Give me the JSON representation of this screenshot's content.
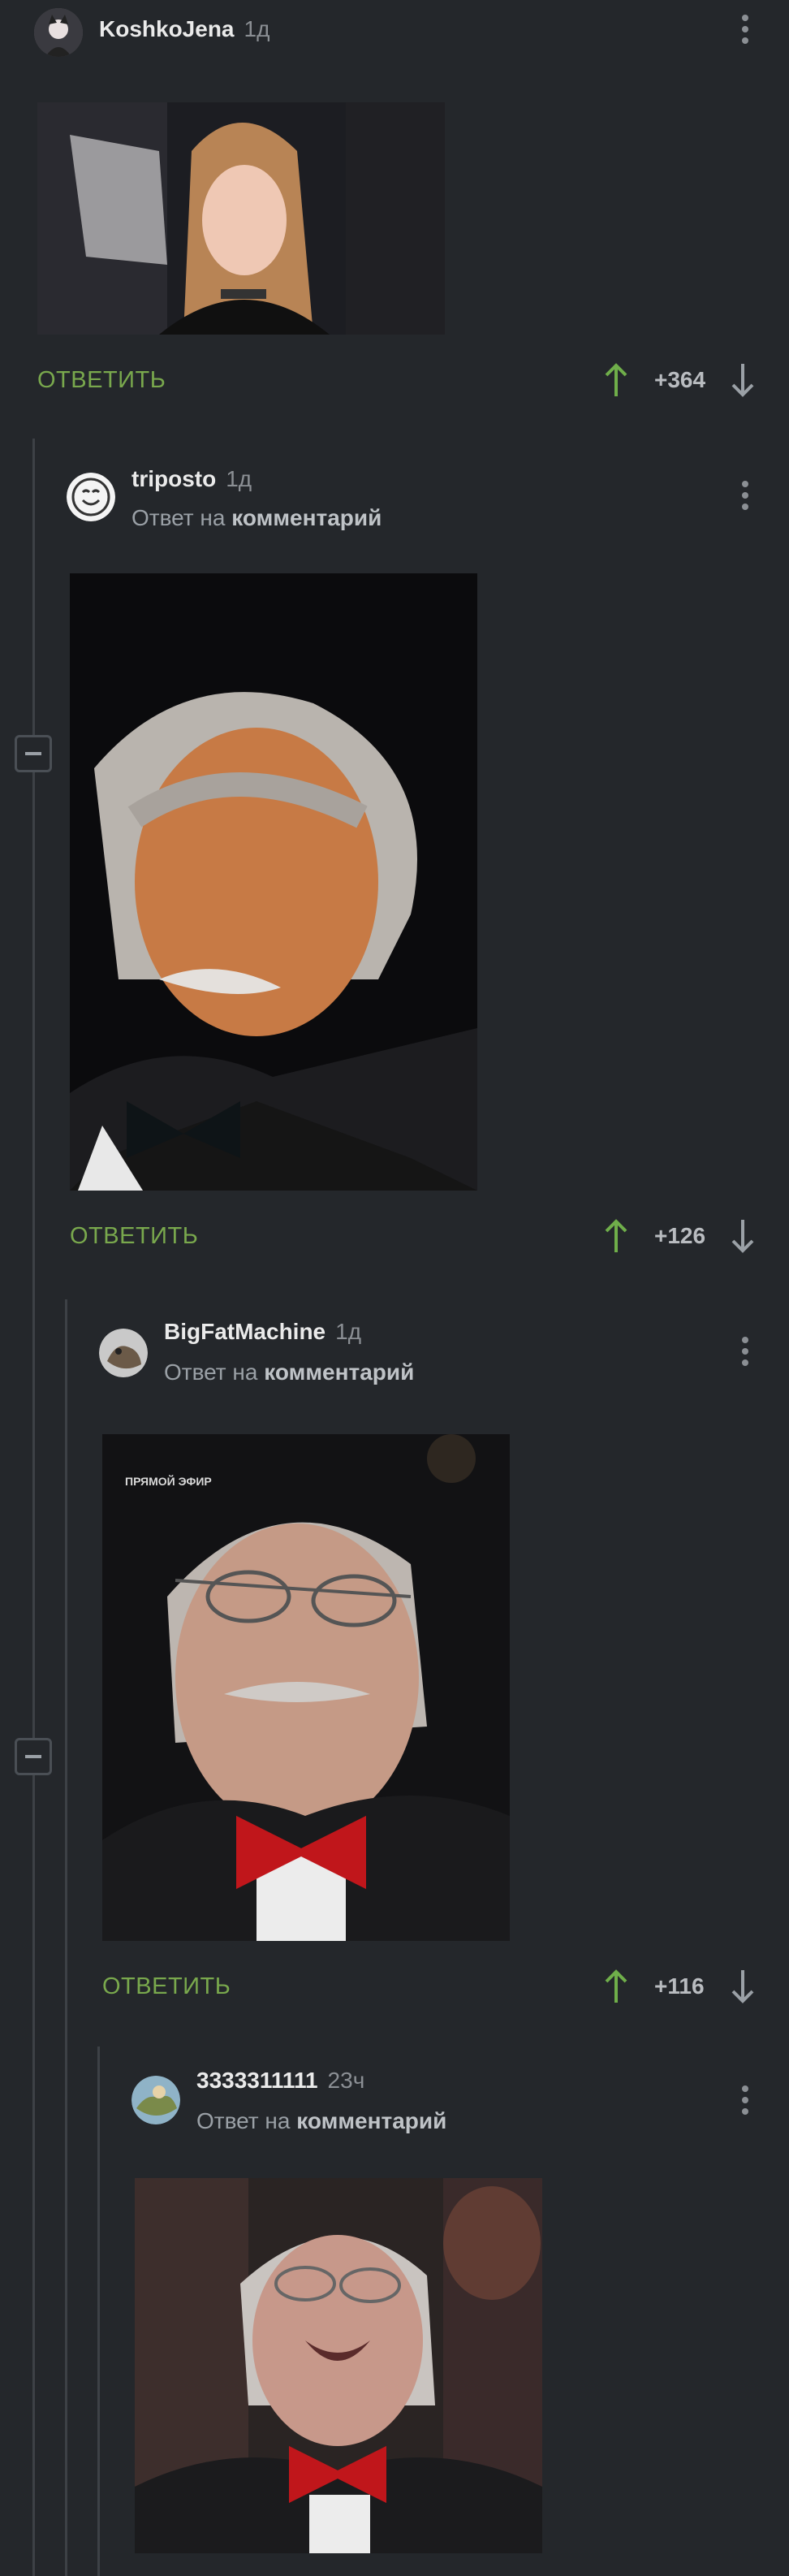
{
  "reply_label": "ОТВЕТИТЬ",
  "reply_to_prefix": "Ответ на",
  "reply_to_target": "комментарий",
  "colors": {
    "background": "#24272b",
    "reply": "#79a84d",
    "upvote": "#6fae4a",
    "thread_line": "#3d4146"
  },
  "comments": [
    {
      "user": "KoshkoJena",
      "time": "1д",
      "score": "+364",
      "image": "photo of a young woman with long hair in a TV studio"
    },
    {
      "user": "triposto",
      "time": "1д",
      "score": "+126",
      "image": "photo of a grey-haired man with moustache smiling, bow tie"
    },
    {
      "user": "BigFatMachine",
      "time": "1д",
      "score": "+116",
      "image_text": "ПРЯМОЙ ЭФИР",
      "image": "photo of a man with glasses and red bow tie grimacing"
    },
    {
      "user": "3333311111",
      "time": "23ч",
      "image": "photo of a man with glasses and red bow tie laughing"
    }
  ]
}
